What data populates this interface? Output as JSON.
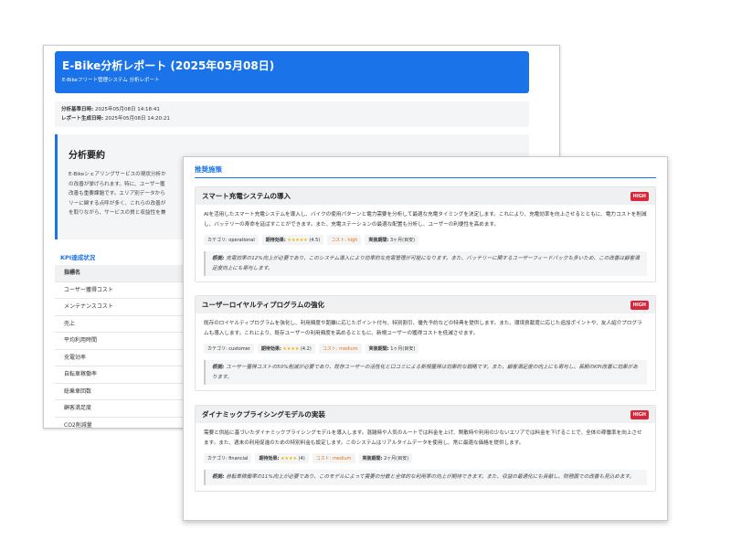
{
  "report": {
    "title": "E-Bike分析レポート (2025年05月08日)",
    "subtitle": "E-Bikeフリート管理システム 分析レポート",
    "meta": [
      {
        "label": "分析基準日時:",
        "value": "2025年05月08日 14:18:41"
      },
      {
        "label": "レポート生成日時:",
        "value": "2025年05月08日 14:20:21"
      }
    ],
    "summary": {
      "heading": "分析要約",
      "lines": [
        "E-Bikeシェアリングサービスの現状分析か",
        "の改善が挙げられます。特に、ユーザー獲",
        "改善も重要課題です。エリア別データから",
        "リーに関する点呼が多く、これらの改善が",
        "を取りながら、サービスの質と収益性を兼"
      ]
    },
    "kpi": {
      "title": "KPI達成状況",
      "header": "指標名",
      "rows": [
        "ユーザー獲得コスト",
        "メンテナンスコスト",
        "売上",
        "平均利用時間",
        "充電効率",
        "自転車稼働率",
        "総乗車回数",
        "顧客満足度",
        "CO2削減量"
      ]
    }
  },
  "recommendations": {
    "title": "推奨施策",
    "labels": {
      "category": "カテゴリ:",
      "effect": "期待効果:",
      "cost": "コスト:",
      "period": "実装期間:",
      "effect_note": "根拠:"
    },
    "items": [
      {
        "title": "スマート充電システムの導入",
        "priority": "HIGH",
        "description": "AIを活用したスマート充電システムを導入し、バイクの使用パターンと電力需要を分析して最適な充電タイミングを決定します。これにより、充電効率を向上させるとともに、電力コストを削減し、バッテリーの寿命を延ばすことができます。また、充電ステーションの最適な配置も分析し、ユーザーの利便性を高めます。",
        "category": "operational",
        "stars": "★★★★★",
        "rating": "(4.5)",
        "cost": "high",
        "period": "3ヶ月(目安)",
        "rationale": "充電効率の12%向上が必要であり、このシステム導入により効率的な充電管理が可能になります。また、バッテリーに関するユーザーフィードバックも多いため、この改善は顧客満足度向上にも寄与します。"
      },
      {
        "title": "ユーザーロイヤルティプログラムの強化",
        "priority": "HIGH",
        "description": "既存のロイヤルティプログラムを強化し、利用頻度や距離に応じたポイント付与、特別割引、優先予約などの特典を提供します。また、環境貢献度に応じた追加ポイントや、友人紹介プログラムも導入します。これにより、既存ユーザーの利用頻度を高めるとともに、新規ユーザーの獲得コストを低減させます。",
        "category": "customer",
        "stars": "★★★★",
        "rating": "(4.2)",
        "cost": "medium",
        "period": "1ヶ月(目安)",
        "rationale": "ユーザー獲得コストの50%削減が必要であり、既存ユーザーの活性化と口コミによる新規獲得は効果的な戦略です。また、顧客満足度の向上にも寄与し、長期のKPI改善に効果があります。"
      },
      {
        "title": "ダイナミックプライシングモデルの実装",
        "priority": "HIGH",
        "description": "需要と供給に基づいたダイナミックプライシングモデルを導入します。混雑時や人気のルートでは料金を上げ、閑散時や利用の少ないエリアでは料金を下げることで、全体の稼働率を向上させます。また、週末の利用促進のための特別料金も設定します。このシステムはリアルタイムデータを使用し、常に最適な価格を提供します。",
        "category": "financial",
        "stars": "★★★★",
        "rating": "(4)",
        "cost": "medium",
        "period": "2ヶ月(目安)",
        "rationale": "自転車稼働率の11%向上が必要であり、このモデルによって需要の分散と全体的な利用率の向上が期待できます。また、収益の最適化にも貢献し、財務面での改善も見込めます。"
      }
    ]
  }
}
